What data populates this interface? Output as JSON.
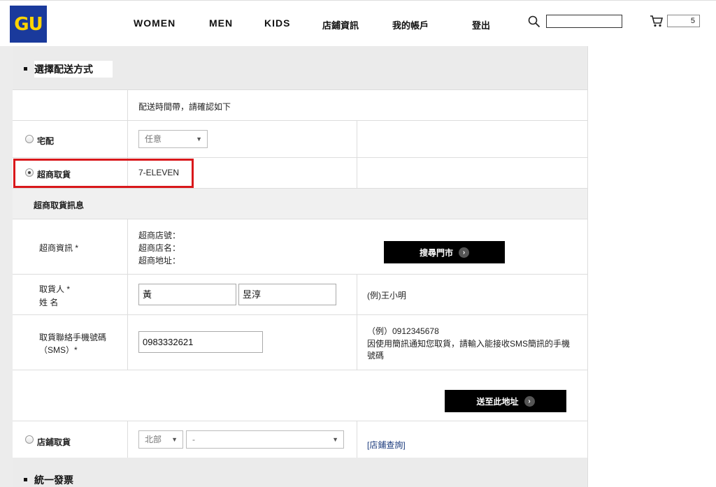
{
  "header": {
    "logo": "GU",
    "nav": [
      "WOMEN",
      "MEN",
      "KIDS",
      "店鋪資訊",
      "我的帳戶",
      "登出"
    ],
    "cart_count": "5"
  },
  "section1": {
    "title": "選擇配送方式"
  },
  "delivery": {
    "time_note": "配送時間帶，請確認如下",
    "home": {
      "label": "宅配",
      "time_select": "任意"
    },
    "store_pickup": {
      "label": "超商取貨",
      "store": "7-ELEVEN"
    },
    "pickup_info_title": "超商取貨訊息",
    "store_info": {
      "label": "超商資訊 *",
      "fields": [
        "超商店號：",
        "超商店名：",
        "超商地址："
      ],
      "search_button": "搜尋門市"
    },
    "recipient": {
      "label_line1": "取貨人 *",
      "label_line2": "姓 名",
      "last_name": "黃",
      "first_name": "昱淳",
      "example": "(例)王小明"
    },
    "phone": {
      "label_line1": "取貨聯絡手機號碼",
      "label_line2": "（SMS）*",
      "value": "0983332621",
      "example": "（例）0912345678",
      "note_line1": "因使用簡訊通知您取貨，請輸入能接收SMS簡訊的手機",
      "note_line2": "號碼"
    },
    "send_button": "送至此地址",
    "shop_pickup": {
      "label": "店鋪取貨",
      "region_select": "北部",
      "shop_select": "-",
      "query_link": "[店鋪查詢]"
    }
  },
  "section2": {
    "title": "統一發票"
  }
}
